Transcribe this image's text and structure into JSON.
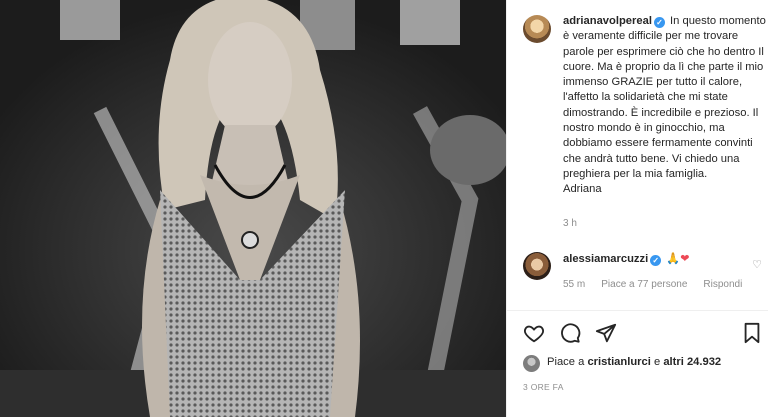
{
  "post": {
    "username": "adrianavolpereal",
    "caption": "In questo momento è veramente difficile per me trovare parole per esprimere ciò che ho dentro Il cuore. Ma è proprio da lì che parte il mio immenso GRAZIE per tutto il calore, l'affetto la solidarietà che mi state dimostrando. È incredibile e prezioso. Il nostro mondo è in ginocchio, ma dobbiamo essere fermamente convinti che andrà tutto bene. Vi chiedo una preghiera per la mia famiglia.",
    "signature": "Adriana",
    "time": "3 h"
  },
  "comment": {
    "username": "alessiamarcuzzi",
    "emoji": "🙏",
    "heart": "❤",
    "time": "55 m",
    "likes": "Piace a 77 persone",
    "reply": "Rispondi"
  },
  "likes": {
    "prefix": "Piace a ",
    "user": "cristianlurci",
    "middle": " e ",
    "others": "altri 24.932"
  },
  "date": "3 ORE FA",
  "colors": {
    "verified": "#3897f0",
    "heart": "#ed4956",
    "muted": "#8e8e8e"
  }
}
